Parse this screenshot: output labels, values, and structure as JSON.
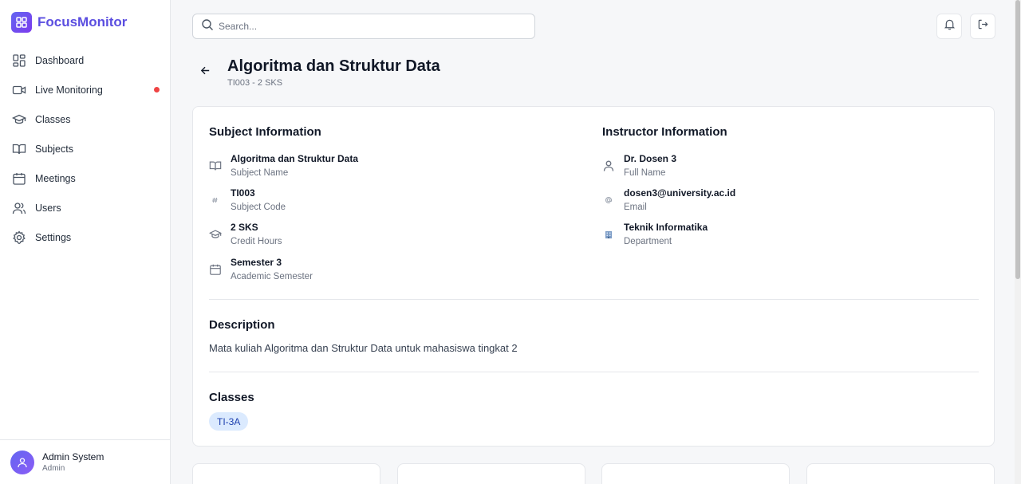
{
  "app": {
    "name": "FocusMonitor",
    "accent": "#5b4ee0",
    "live_dot_color": "#ef4444"
  },
  "sidebar": {
    "items": [
      {
        "label": "Dashboard",
        "icon": "dashboard-icon"
      },
      {
        "label": "Live Monitoring",
        "icon": "video-icon",
        "live": true
      },
      {
        "label": "Classes",
        "icon": "graduation-cap-icon"
      },
      {
        "label": "Subjects",
        "icon": "book-icon"
      },
      {
        "label": "Meetings",
        "icon": "calendar-icon"
      },
      {
        "label": "Users",
        "icon": "users-icon"
      },
      {
        "label": "Settings",
        "icon": "gear-icon"
      }
    ],
    "user": {
      "name": "Admin System",
      "role": "Admin"
    }
  },
  "topbar": {
    "search_placeholder": "Search..."
  },
  "page": {
    "title": "Algoritma dan Struktur Data",
    "subtitle": "TI003 - 2 SKS"
  },
  "subject_info": {
    "title": "Subject Information",
    "rows": [
      {
        "value": "Algoritma dan Struktur Data",
        "label": "Subject Name",
        "icon": "book-icon"
      },
      {
        "value": "TI003",
        "label": "Subject Code",
        "icon": "hash-icon"
      },
      {
        "value": "2 SKS",
        "label": "Credit Hours",
        "icon": "graduation-cap-icon"
      },
      {
        "value": "Semester 3",
        "label": "Academic Semester",
        "icon": "calendar-icon"
      }
    ]
  },
  "instructor_info": {
    "title": "Instructor Information",
    "rows": [
      {
        "value": "Dr. Dosen 3",
        "label": "Full Name",
        "icon": "user-icon"
      },
      {
        "value": "dosen3@university.ac.id",
        "label": "Email",
        "icon": "at-icon"
      },
      {
        "value": "Teknik Informatika",
        "label": "Department",
        "icon": "building-icon"
      }
    ]
  },
  "description": {
    "title": "Description",
    "text": "Mata kuliah Algoritma dan Struktur Data untuk mahasiswa tingkat 2"
  },
  "classes": {
    "title": "Classes",
    "items": [
      "TI-3A"
    ]
  }
}
